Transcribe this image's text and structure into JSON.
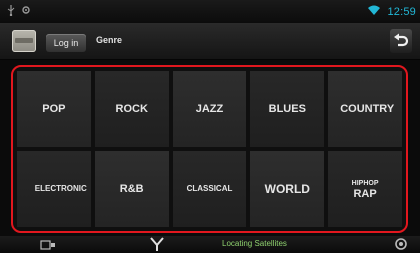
{
  "status_bar": {
    "time": "12:59",
    "colors": {
      "time": "#22b7d6"
    },
    "icons": [
      "usb-icon",
      "settings-icon",
      "wifi-icon"
    ]
  },
  "header": {
    "login_label": "Log in",
    "title": "Genre",
    "back_icon": "back-arrow-icon"
  },
  "genre_grid": {
    "highlight_color": "#e2171e",
    "tiles": [
      {
        "label": "POP"
      },
      {
        "label": "ROCK"
      },
      {
        "label": "JAZZ"
      },
      {
        "label": "BLUES"
      },
      {
        "label": "COUNTRY"
      },
      {
        "label": "ELECTRONIC"
      },
      {
        "label": "R&B"
      },
      {
        "label": "CLASSICAL"
      },
      {
        "label": "WORLD"
      },
      {
        "label_line1": "HIPHOP",
        "label_line2": "RAP"
      }
    ]
  },
  "bottom_bar": {
    "gps_status": "Locating Satellites",
    "colors": {
      "gps_status": "#8fd26f"
    },
    "icons": [
      "media-source-icon",
      "gps-antenna-icon",
      "apps-icon"
    ]
  }
}
